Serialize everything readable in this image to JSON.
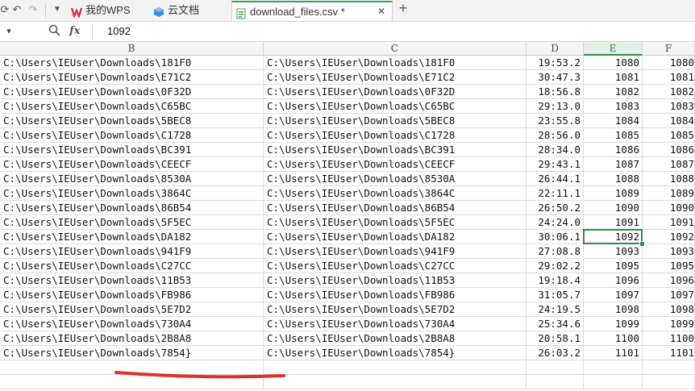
{
  "tabs": [
    {
      "label": "我的WPS",
      "icon": "wps-logo-icon"
    },
    {
      "label": "云文档",
      "icon": "cloud-doc-icon"
    },
    {
      "label": "download_files.csv *",
      "icon": "csv-file-icon",
      "active": true
    }
  ],
  "formula_bar": {
    "fx_label": "fx",
    "value": "1092"
  },
  "columns": [
    "B",
    "C",
    "D",
    "E",
    "F"
  ],
  "selected_column": "E",
  "selected_cell": {
    "column": "E",
    "value": "1092"
  },
  "rows": [
    {
      "b": "C:\\Users\\IEUser\\Downloads\\181F0",
      "c": "C:\\Users\\IEUser\\Downloads\\181F0",
      "d": "19:53.2",
      "e": "1080",
      "f": "1080"
    },
    {
      "b": "C:\\Users\\IEUser\\Downloads\\E71C2",
      "c": "C:\\Users\\IEUser\\Downloads\\E71C2",
      "d": "30:47.3",
      "e": "1081",
      "f": "1081"
    },
    {
      "b": "C:\\Users\\IEUser\\Downloads\\0F32D",
      "c": "C:\\Users\\IEUser\\Downloads\\0F32D",
      "d": "18:56.8",
      "e": "1082",
      "f": "1082"
    },
    {
      "b": "C:\\Users\\IEUser\\Downloads\\C65BC",
      "c": "C:\\Users\\IEUser\\Downloads\\C65BC",
      "d": "29:13.0",
      "e": "1083",
      "f": "1083"
    },
    {
      "b": "C:\\Users\\IEUser\\Downloads\\5BEC8",
      "c": "C:\\Users\\IEUser\\Downloads\\5BEC8",
      "d": "23:55.8",
      "e": "1084",
      "f": "1084"
    },
    {
      "b": "C:\\Users\\IEUser\\Downloads\\C1728",
      "c": "C:\\Users\\IEUser\\Downloads\\C1728",
      "d": "28:56.0",
      "e": "1085",
      "f": "1085"
    },
    {
      "b": "C:\\Users\\IEUser\\Downloads\\BC391",
      "c": "C:\\Users\\IEUser\\Downloads\\BC391",
      "d": "28:34.0",
      "e": "1086",
      "f": "1086"
    },
    {
      "b": "C:\\Users\\IEUser\\Downloads\\CEECF",
      "c": "C:\\Users\\IEUser\\Downloads\\CEECF",
      "d": "29:43.1",
      "e": "1087",
      "f": "1087"
    },
    {
      "b": "C:\\Users\\IEUser\\Downloads\\8530A",
      "c": "C:\\Users\\IEUser\\Downloads\\8530A",
      "d": "26:44.1",
      "e": "1088",
      "f": "1088"
    },
    {
      "b": "C:\\Users\\IEUser\\Downloads\\3864C",
      "c": "C:\\Users\\IEUser\\Downloads\\3864C",
      "d": "22:11.1",
      "e": "1089",
      "f": "1089"
    },
    {
      "b": "C:\\Users\\IEUser\\Downloads\\86B54",
      "c": "C:\\Users\\IEUser\\Downloads\\86B54",
      "d": "26:50.2",
      "e": "1090",
      "f": "1090"
    },
    {
      "b": "C:\\Users\\IEUser\\Downloads\\5F5EC",
      "c": "C:\\Users\\IEUser\\Downloads\\5F5EC",
      "d": "24:24.0",
      "e": "1091",
      "f": "1091"
    },
    {
      "b": "C:\\Users\\IEUser\\Downloads\\DA182",
      "c": "C:\\Users\\IEUser\\Downloads\\DA182",
      "d": "30:06.1",
      "e": "1092",
      "f": "1092"
    },
    {
      "b": "C:\\Users\\IEUser\\Downloads\\941F9",
      "c": "C:\\Users\\IEUser\\Downloads\\941F9",
      "d": "27:08.8",
      "e": "1093",
      "f": "1093"
    },
    {
      "b": "C:\\Users\\IEUser\\Downloads\\C27CC",
      "c": "C:\\Users\\IEUser\\Downloads\\C27CC",
      "d": "29:02.2",
      "e": "1095",
      "f": "1095"
    },
    {
      "b": "C:\\Users\\IEUser\\Downloads\\11B53",
      "c": "C:\\Users\\IEUser\\Downloads\\11B53",
      "d": "19:18.4",
      "e": "1096",
      "f": "1096"
    },
    {
      "b": "C:\\Users\\IEUser\\Downloads\\FB986",
      "c": "C:\\Users\\IEUser\\Downloads\\FB986",
      "d": "31:05.7",
      "e": "1097",
      "f": "1097"
    },
    {
      "b": "C:\\Users\\IEUser\\Downloads\\5E7D2",
      "c": "C:\\Users\\IEUser\\Downloads\\5E7D2",
      "d": "24:19.5",
      "e": "1098",
      "f": "1098"
    },
    {
      "b": "C:\\Users\\IEUser\\Downloads\\730A4",
      "c": "C:\\Users\\IEUser\\Downloads\\730A4",
      "d": "25:34.6",
      "e": "1099",
      "f": "1099"
    },
    {
      "b": "C:\\Users\\IEUser\\Downloads\\2B8A8",
      "c": "C:\\Users\\IEUser\\Downloads\\2B8A8",
      "d": "20:58.1",
      "e": "1100",
      "f": "1100"
    },
    {
      "b": "C:\\Users\\IEUser\\Downloads\\7854}",
      "c": "C:\\Users\\IEUser\\Downloads\\7854}",
      "d": "26:03.2",
      "e": "1101",
      "f": "1101"
    },
    {
      "b": "",
      "c": "",
      "d": "",
      "e": "",
      "f": ""
    },
    {
      "b": "",
      "c": "",
      "d": "",
      "e": "",
      "f": ""
    }
  ],
  "colors": {
    "accent": "#2e8b4f",
    "annotation_stroke": "#e0302e"
  }
}
